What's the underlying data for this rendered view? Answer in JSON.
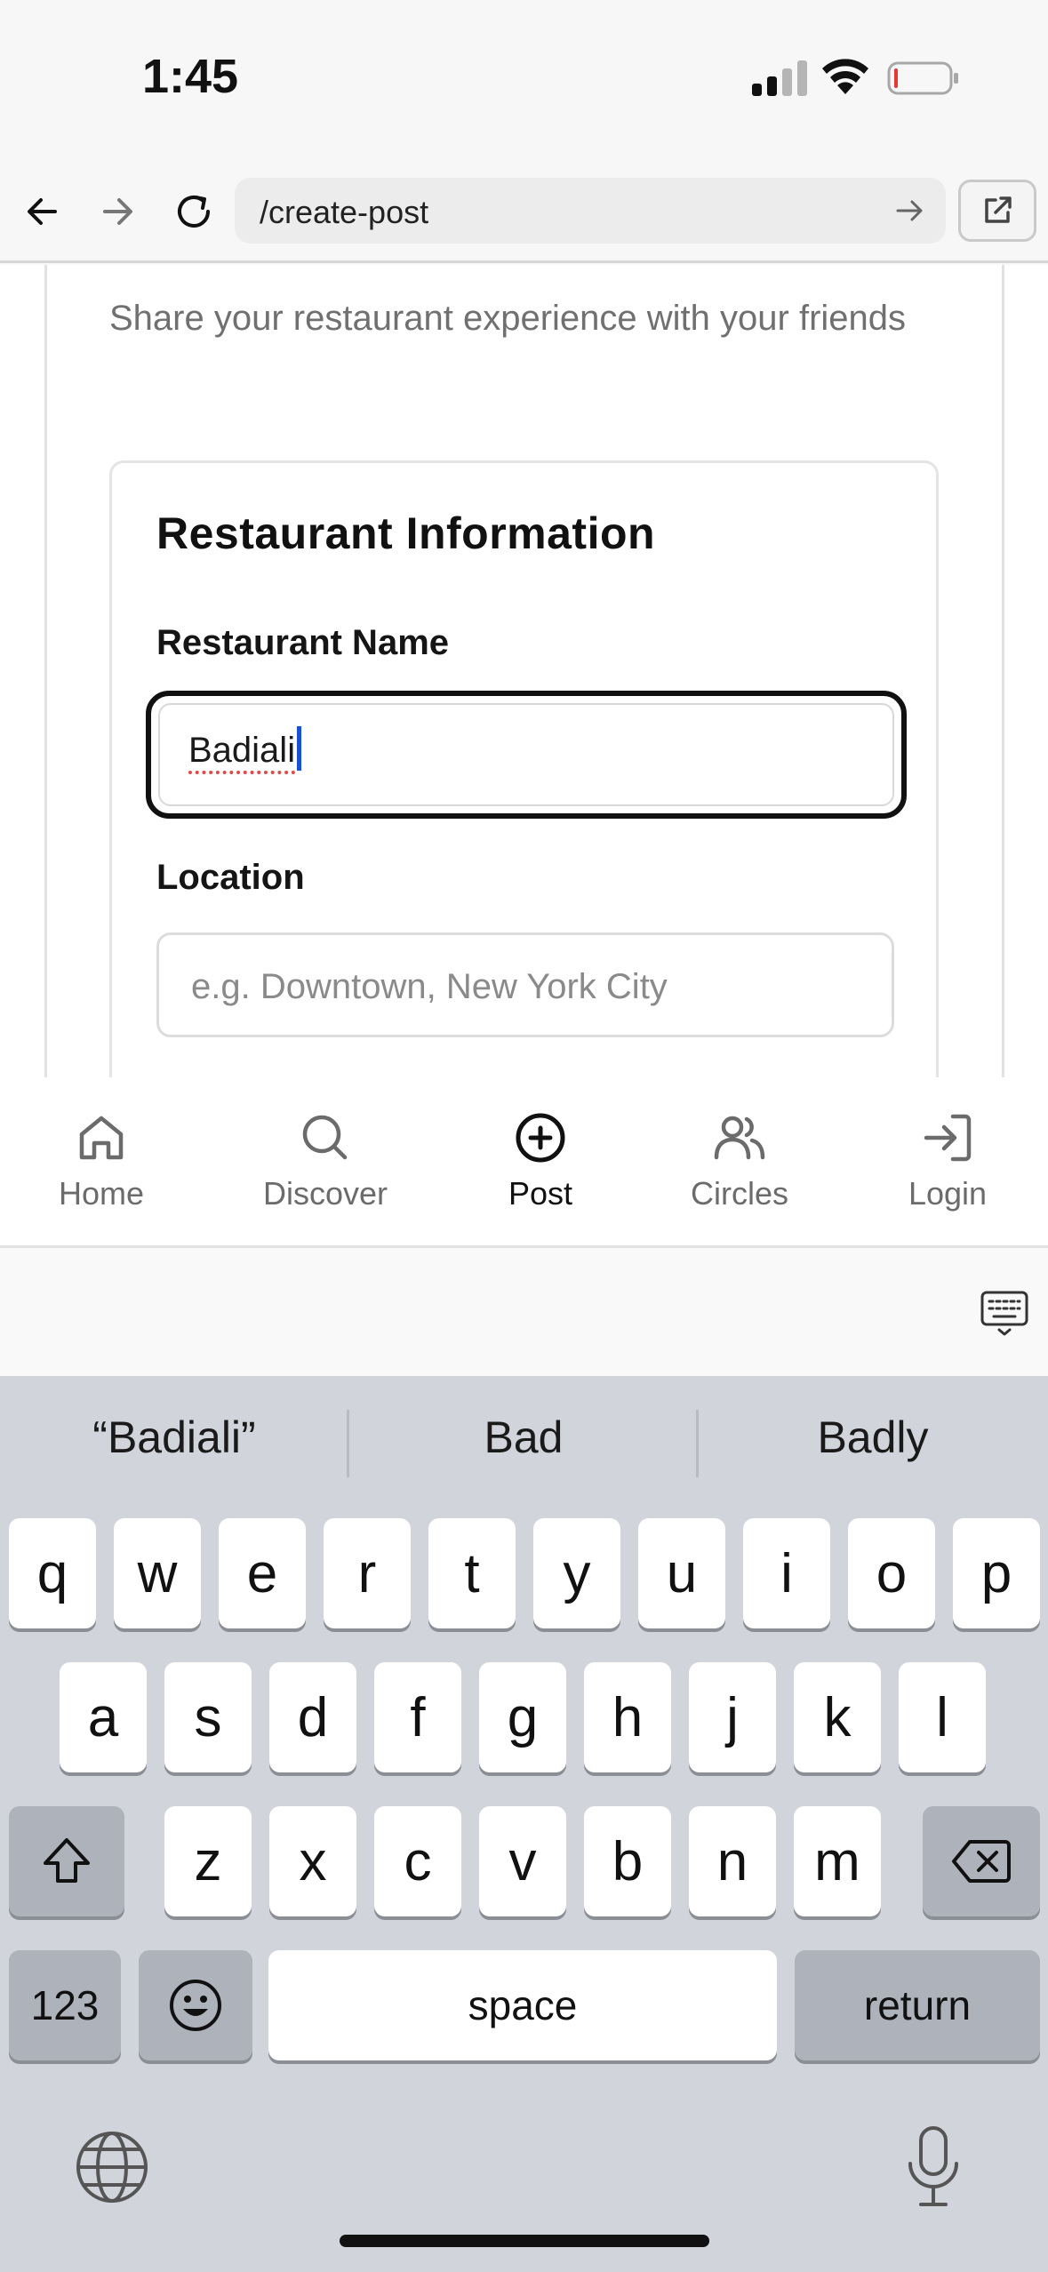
{
  "status_bar": {
    "time": "1:45"
  },
  "browser": {
    "url": "/create-post"
  },
  "page": {
    "subtitle": "Share your restaurant experience with your friends",
    "card": {
      "title": "Restaurant Information",
      "restaurant_name": {
        "label": "Restaurant Name",
        "value": "Badiali"
      },
      "location": {
        "label": "Location",
        "value": "",
        "placeholder": "e.g. Downtown, New York City"
      }
    }
  },
  "bottom_nav": {
    "items": [
      {
        "label": "Home",
        "icon": "home-icon"
      },
      {
        "label": "Discover",
        "icon": "search-icon"
      },
      {
        "label": "Post",
        "icon": "plus-circle-icon",
        "active": true
      },
      {
        "label": "Circles",
        "icon": "users-icon"
      },
      {
        "label": "Login",
        "icon": "login-icon"
      }
    ]
  },
  "keyboard": {
    "suggestions": [
      "“Badiali”",
      "Bad",
      "Badly"
    ],
    "row1": [
      "q",
      "w",
      "e",
      "r",
      "t",
      "y",
      "u",
      "i",
      "o",
      "p"
    ],
    "row2": [
      "a",
      "s",
      "d",
      "f",
      "g",
      "h",
      "j",
      "k",
      "l"
    ],
    "row3": [
      "z",
      "x",
      "c",
      "v",
      "b",
      "n",
      "m"
    ],
    "numbers_label": "123",
    "space_label": "space",
    "return_label": "return"
  },
  "colors": {
    "caret": "#1a4fd8",
    "keyboard_bg": "#d1d4db",
    "battery_low": "#e53935"
  }
}
